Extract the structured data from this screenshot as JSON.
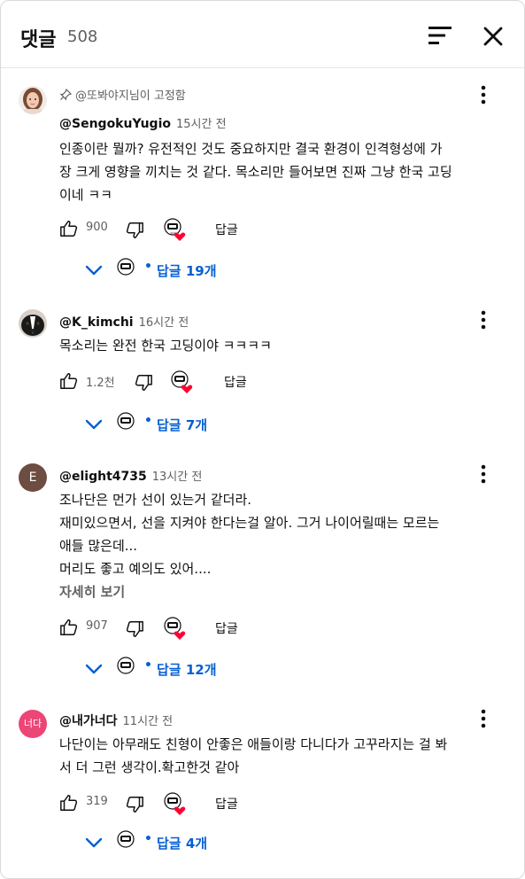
{
  "header": {
    "title": "댓글",
    "count": "508"
  },
  "comments": [
    {
      "pinned_label": "@또봐야지님이 고정함",
      "handle": "@SengokuYugio",
      "time": "15시간 전",
      "text": "인종이란 뭘까? 유전적인 것도 중요하지만 결국 환경이 인격형성에 가\n장 크게 영향을 끼치는 것 같다. 목소리만 들어보면 진짜 그냥 한국 고딩\n이네 ㅋㅋ",
      "likes": "900",
      "reply_label": "답글",
      "replies_label": "답글 19개",
      "avatar": "woman-photo"
    },
    {
      "handle": "@K_kimchi",
      "time": "16시간 전",
      "text": "목소리는 완전 한국 고딩이야 ㅋㅋㅋㅋ",
      "likes": "1.2천",
      "reply_label": "답글",
      "replies_label": "답글 7개",
      "avatar": "dog-photo"
    },
    {
      "handle": "@elight4735",
      "time": "13시간 전",
      "avatar_letter": "E",
      "text": "조나단은 먼가 선이 있는거 같더라.\n재미있으면서, 선을 지켜야 한다는걸 알아. 그거 나이어릴때는 모르는\n애들 많은데...\n머리도 좋고 예의도 있어....",
      "read_more": "자세히 보기",
      "likes": "907",
      "reply_label": "답글",
      "replies_label": "답글 12개"
    },
    {
      "handle": "@내가너다",
      "time": "11시간 전",
      "avatar_letter": "너다",
      "text": "나단이는 아무래도 친형이 안좋은 애들이랑 다니다가 고꾸라지는 걸 봐\n서 더 그런 생각이.확고한것 같아",
      "likes": "319",
      "reply_label": "답글",
      "replies_label": "답글 4개"
    }
  ],
  "colors": {
    "link": "#065fd4",
    "secondary": "#606060",
    "heart": "#ff0033"
  },
  "icons": [
    "sort-icon",
    "close-icon",
    "pin-icon",
    "more-vertical-icon",
    "thumbs-up-icon",
    "thumbs-down-icon",
    "creator-heart-icon",
    "chevron-down-icon"
  ]
}
